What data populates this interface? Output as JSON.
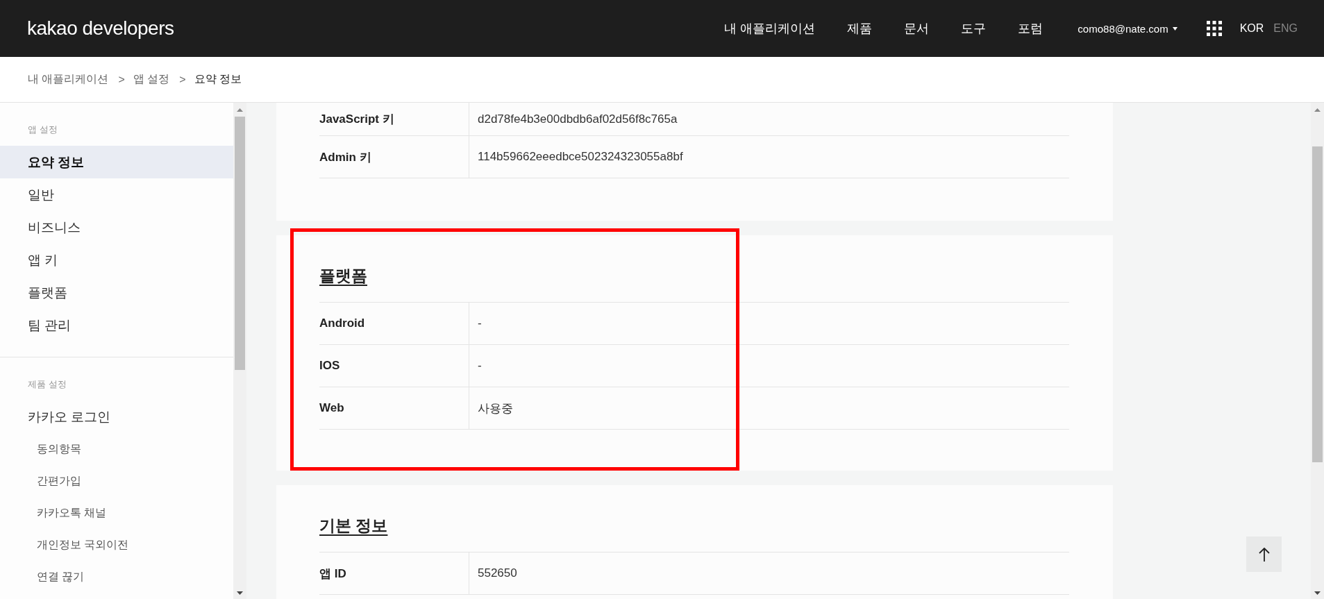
{
  "header": {
    "logo": "kakao developers",
    "nav": [
      "내 애플리케이션",
      "제품",
      "문서",
      "도구",
      "포럼"
    ],
    "account": "como88@nate.com",
    "languages": [
      {
        "label": "KOR",
        "selected": true
      },
      {
        "label": "ENG",
        "selected": false
      }
    ]
  },
  "breadcrumb": [
    {
      "label": "내 애플리케이션",
      "current": false
    },
    {
      "separator": ">",
      "label": "앱 설정",
      "current": false
    },
    {
      "separator": ">",
      "label": "요약 정보",
      "current": true
    }
  ],
  "sidebar": {
    "sections": [
      {
        "title": "앱 설정",
        "items": [
          {
            "label": "요약 정보",
            "selected": true
          },
          {
            "label": "일반",
            "selected": false
          },
          {
            "label": "비즈니스",
            "selected": false
          },
          {
            "label": "앱 키",
            "selected": false
          },
          {
            "label": "플랫폼",
            "selected": false
          },
          {
            "label": "팀 관리",
            "selected": false
          }
        ]
      },
      {
        "title": "제품 설정",
        "items": [
          {
            "label": "카카오 로그인",
            "selected": false,
            "children": [
              {
                "label": "동의항목",
                "selected": false
              },
              {
                "label": "간편가입",
                "selected": false
              },
              {
                "label": "카카오톡 채널",
                "selected": false
              },
              {
                "label": "개인정보 국외이전",
                "selected": false
              },
              {
                "label": "연결 끊기",
                "selected": false
              }
            ]
          }
        ]
      }
    ]
  },
  "sections": [
    {
      "highlighted": false,
      "rows": [
        {
          "label": "JavaScript 키",
          "value": "d2d78fe4b3e00dbdb6af02d56f8c765a"
        },
        {
          "label": "Admin 키",
          "value": "114b59662eeedbce502324323055a8bf"
        }
      ]
    },
    {
      "title": "플랫폼",
      "highlighted": true,
      "rows": [
        {
          "label": "Android",
          "value": "-"
        },
        {
          "label": "IOS",
          "value": "-"
        },
        {
          "label": "Web",
          "value": "사용중"
        }
      ]
    },
    {
      "title": "기본 정보",
      "highlighted": false,
      "rows": [
        {
          "label": "앱 ID",
          "value": "552650"
        }
      ]
    }
  ]
}
